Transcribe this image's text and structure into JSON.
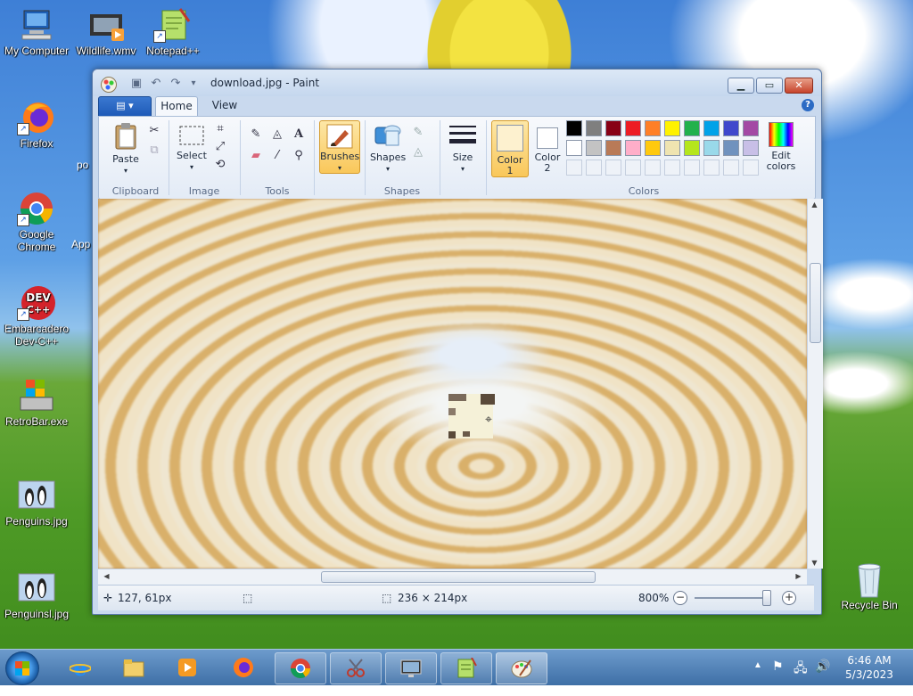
{
  "desktop": {
    "icons": [
      {
        "label": "My Computer"
      },
      {
        "label": "Wildlife.wmv"
      },
      {
        "label": "Notepad++"
      },
      {
        "label": "Firefox"
      },
      {
        "label": "Google Chrome"
      },
      {
        "label": "Embarcadero Dev-C++"
      },
      {
        "label": "RetroBar.exe"
      },
      {
        "label": "Penguins.jpg"
      },
      {
        "label": "Penguinsl.jpg"
      },
      {
        "label": "Recycle Bin"
      }
    ],
    "partial_labels": [
      "po",
      "App"
    ]
  },
  "window": {
    "title": "download.jpg - Paint",
    "minimize": "▁",
    "maximize": "▭",
    "close": "✕"
  },
  "tabs": {
    "file": "▾",
    "home": "Home",
    "view": "View",
    "help": "?"
  },
  "ribbon": {
    "clipboard": {
      "paste": "Paste",
      "group": "Clipboard"
    },
    "image": {
      "select": "Select",
      "group": "Image"
    },
    "tools": {
      "group": "Tools"
    },
    "brushes": "Brushes",
    "shapes": {
      "label": "Shapes",
      "group": "Shapes"
    },
    "size": "Size",
    "color1": {
      "line1": "Color",
      "line2": "1"
    },
    "color2": {
      "line1": "Color",
      "line2": "2"
    },
    "edit_colors": {
      "line1": "Edit",
      "line2": "colors"
    },
    "colors_group": "Colors",
    "color1_value": "#fdf1cf",
    "color2_value": "#ffffff",
    "palette_row1": [
      "#000000",
      "#7f7f7f",
      "#880015",
      "#ed1c24",
      "#ff7f27",
      "#fff200",
      "#22b14c",
      "#00a2e8",
      "#3f48cc",
      "#a349a4"
    ],
    "palette_row2": [
      "#ffffff",
      "#c3c3c3",
      "#b97a57",
      "#ffaec9",
      "#ffc90e",
      "#efe4b0",
      "#b5e61d",
      "#99d9ea",
      "#7092be",
      "#c8bfe7"
    ]
  },
  "status": {
    "cursor_pos": "127, 61px",
    "image_size": "236 × 214px",
    "zoom": "800%",
    "zoom_minus": "−",
    "zoom_plus": "+"
  },
  "taskbar": {
    "time": "6:46 AM",
    "date": "5/3/2023"
  }
}
